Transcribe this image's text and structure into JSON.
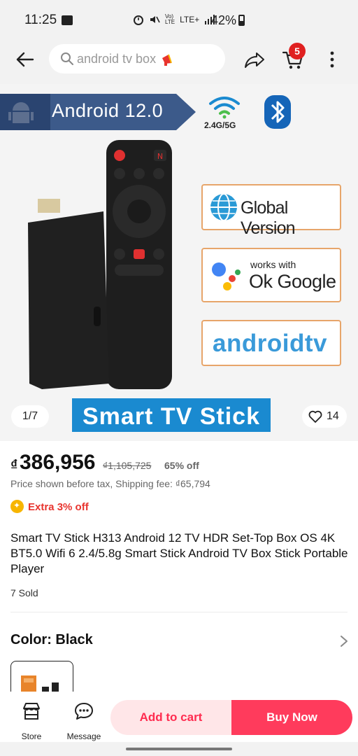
{
  "status_bar": {
    "time": "11:25",
    "lte_label": "LTE+",
    "battery": "42%"
  },
  "top_nav": {
    "search_placeholder": "android tv box",
    "cart_count": "5"
  },
  "gallery": {
    "android_banner": "Android 12.0",
    "wifi_label": "2.4G/5G",
    "features": {
      "global": "Global Version",
      "google_small": "works with",
      "google_big": "Ok Google",
      "atv": "androidtv"
    },
    "stick_banner": "Smart TV Stick",
    "image_counter": "1/7",
    "favorites": "14"
  },
  "product": {
    "currency": "₫",
    "price": "386,956",
    "original_price": "₫1,105,725",
    "discount": "65% off",
    "tax_note": "Price shown before tax, Shipping fee: ₫65,794",
    "extra_discount": "Extra 3% off",
    "title": "Smart TV Stick H313 Android 12 TV HDR Set-Top Box OS 4K BT5.0 Wifi 6 2.4/5.8g Smart Stick Android TV Box Stick Portable Player",
    "sold": "7 Sold",
    "color_label": "Color: Black"
  },
  "bottom_bar": {
    "store_label": "Store",
    "message_label": "Message",
    "add_to_cart": "Add to cart",
    "buy_now": "Buy Now"
  },
  "colors": {
    "accent": "#ff3b5c",
    "accent_light": "#ffe6e8",
    "badge": "#e02020",
    "extra": "#e8342e",
    "banner_blue": "#1a8ad0"
  }
}
